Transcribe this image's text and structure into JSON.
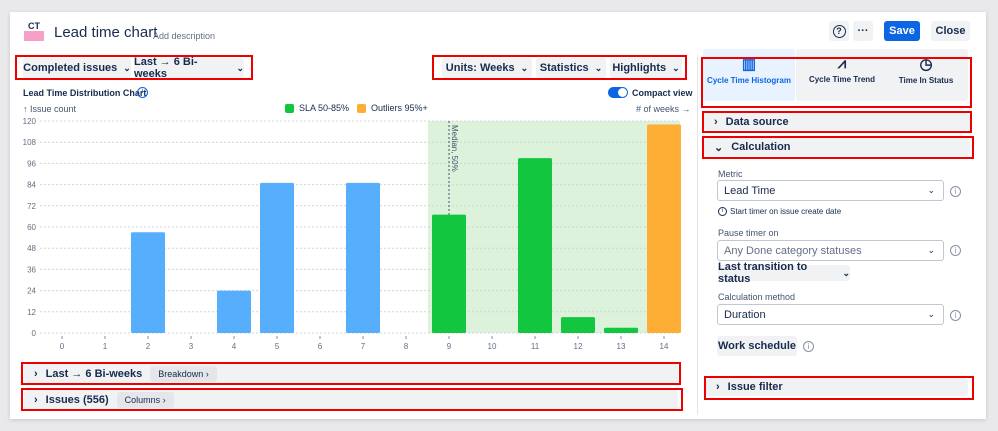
{
  "header": {
    "logo": "CT",
    "title": "Lead time chart",
    "add_description": "Add description",
    "help": "?",
    "more": "···",
    "save": "Save",
    "close": "Close"
  },
  "toolbar": {
    "issues_filter": "Completed issues",
    "period": "Last → 6 Bi-weeks",
    "units": "Units: Weeks",
    "statistics": "Statistics",
    "highlights": "Highlights"
  },
  "chart_header": {
    "title": "Lead Time Distribution Chart",
    "compact_view": "Compact view",
    "y_hint": "↑ Issue count",
    "x_hint": "# of weeks →",
    "median_label": "Median, 50%"
  },
  "colors": {
    "normal": "#57aefd",
    "sla": "#12c640",
    "outlier": "#feae35",
    "sla_zone": "#dcf2da",
    "accent": "#0c66e4"
  },
  "chart_data": {
    "type": "bar",
    "title": "Lead Time Distribution Chart",
    "xlabel": "# of weeks",
    "ylabel": "Issue count",
    "ylim": [
      0,
      120
    ],
    "yticks": [
      0,
      12,
      24,
      36,
      48,
      60,
      72,
      84,
      96,
      108,
      120
    ],
    "categories": [
      "0",
      "1",
      "2",
      "3",
      "4",
      "5",
      "6",
      "7",
      "8",
      "9",
      "10",
      "11",
      "12",
      "13",
      "14"
    ],
    "values": [
      0,
      0,
      57,
      0,
      24,
      85,
      0,
      85,
      0,
      67,
      0,
      99,
      9,
      3,
      118
    ],
    "groups": [
      "normal",
      "normal",
      "normal",
      "normal",
      "normal",
      "normal",
      "normal",
      "normal",
      "normal",
      "sla",
      "sla",
      "sla",
      "sla",
      "sla",
      "outlier"
    ],
    "legend": [
      {
        "label": "SLA 50-85%",
        "color": "#12c640"
      },
      {
        "label": "Outliers 95%+",
        "color": "#feae35"
      }
    ],
    "legend_position": "top-center",
    "median_x": 9,
    "grid": true
  },
  "bottom": {
    "breakdown_title": "Last → 6 Bi-weeks",
    "breakdown_btn": "Breakdown",
    "issues_title": "Issues (556)",
    "columns_btn": "Columns"
  },
  "panel": {
    "tabs": [
      {
        "label": "Cycle Time Histogram",
        "icon": "histogram-icon"
      },
      {
        "label": "Cycle Time Trend",
        "icon": "trend-icon"
      },
      {
        "label": "Time In Status",
        "icon": "time-in-status-icon"
      }
    ],
    "data_source": "Data source",
    "calculation": "Calculation",
    "metric_label": "Metric",
    "metric_value": "Lead Time",
    "metric_hint": "Start timer on issue create date",
    "pause_label": "Pause timer on",
    "pause_placeholder": "Any Done category statuses",
    "transition": "Last transition to status",
    "method_label": "Calculation method",
    "method_value": "Duration",
    "work_schedule": "Work schedule",
    "issue_filter": "Issue filter"
  }
}
